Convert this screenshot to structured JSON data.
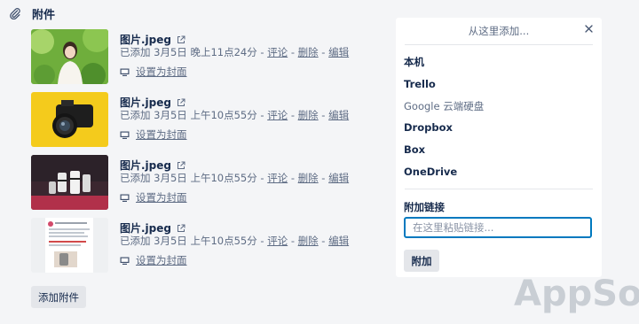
{
  "section": {
    "title": "附件",
    "icon": "paperclip-icon"
  },
  "attachments": [
    {
      "name": "图片.jpeg",
      "added": "已添加 3月5日 晚上11点24分",
      "comment": "评论",
      "delete": "删除",
      "edit": "编辑",
      "cover": "设置为封面",
      "thumb_desc": "woman-in-garden"
    },
    {
      "name": "图片.jpeg",
      "added": "已添加 3月5日 上午10点55分",
      "comment": "评论",
      "delete": "删除",
      "edit": "编辑",
      "cover": "设置为封面",
      "thumb_desc": "camera-on-yellow"
    },
    {
      "name": "图片.jpeg",
      "added": "已添加 3月5日 上午10点55分",
      "comment": "评论",
      "delete": "删除",
      "edit": "编辑",
      "cover": "设置为封面",
      "thumb_desc": "lenses-on-red"
    },
    {
      "name": "图片.jpeg",
      "added": "已添加 3月5日 上午10点55分",
      "comment": "评论",
      "delete": "删除",
      "edit": "编辑",
      "cover": "设置为封面",
      "thumb_desc": "chat-screenshot"
    }
  ],
  "separator": " - ",
  "add_attachment_button": "添加附件",
  "popover": {
    "title": "从这里添加...",
    "sources": [
      "本机",
      "Trello",
      "Google 云端硬盘",
      "Dropbox",
      "Box",
      "OneDrive"
    ],
    "link_label": "附加链接",
    "link_placeholder": "在这里粘贴链接...",
    "attach_button": "附加"
  },
  "watermark": "AppSo",
  "colors": {
    "link_input_border": "#0079bf",
    "background": "#f4f5f7"
  }
}
